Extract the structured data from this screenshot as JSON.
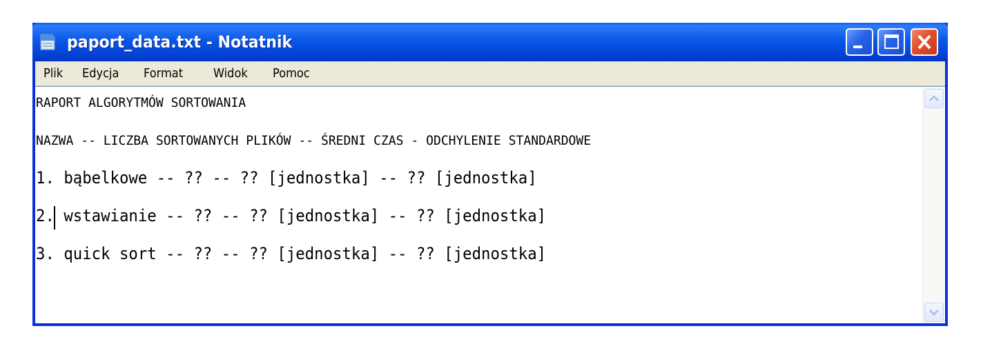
{
  "window": {
    "title": "paport_data.txt - Notatnik",
    "colors": {
      "titlebar": "#0a58e8",
      "close": "#e0502c",
      "menubar": "#ece9d8"
    }
  },
  "menu": {
    "items": [
      {
        "label": "Plik"
      },
      {
        "label": "Edycja"
      },
      {
        "label": "Format"
      },
      {
        "label": "Widok"
      },
      {
        "label": "Pomoc"
      }
    ]
  },
  "document": {
    "lines": [
      "RAPORT ALGORYTMÓW SORTOWANIA",
      "NAZWA -- LICZBA SORTOWANYCH PLIKÓW -- ŚREDNI CZAS - ODCHYLENIE STANDARDOWE",
      "1. bąbelkowe -- ?? -- ?? [jednostka] -- ?? [jednostka]",
      "2. wstawianie -- ?? -- ?? [jednostka] -- ?? [jednostka]",
      "3. quick sort -- ?? -- ?? [jednostka] -- ?? [jednostka]"
    ]
  },
  "icons": {
    "app": "notepad-icon",
    "minimize": "minimize-icon",
    "maximize": "maximize-icon",
    "close": "close-icon",
    "scroll_up": "arrow-up-icon",
    "scroll_down": "arrow-down-icon"
  }
}
